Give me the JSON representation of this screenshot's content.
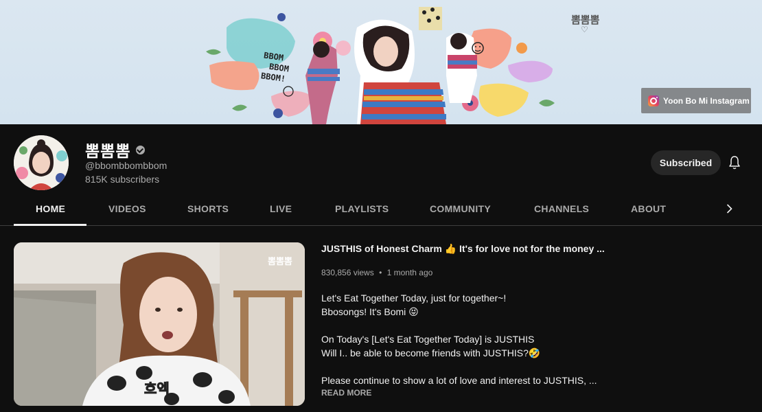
{
  "banner": {
    "brand_logo": "뽐뽐뽐",
    "bbom_text": [
      "BBOM",
      "BBOM",
      "BBOM!"
    ],
    "link_label": "Yoon Bo Mi Instagram",
    "link_icon": "instagram-icon"
  },
  "channel": {
    "name": "뽐뽐뽐",
    "handle": "@bbombbombbom",
    "subscribers": "815K subscribers",
    "subscribe_label": "Subscribed",
    "verified_icon": "verified-check-icon",
    "bell_icon": "bell-icon"
  },
  "tabs": [
    {
      "label": "HOME",
      "active": true
    },
    {
      "label": "VIDEOS"
    },
    {
      "label": "SHORTS"
    },
    {
      "label": "LIVE"
    },
    {
      "label": "PLAYLISTS"
    },
    {
      "label": "COMMUNITY"
    },
    {
      "label": "CHANNELS"
    },
    {
      "label": "ABOUT"
    }
  ],
  "featured": {
    "title": "JUSTHIS of Honest Charm 👍 It's for love not for the money ...",
    "views": "830,856 views",
    "age": "1 month ago",
    "separator": "•",
    "thumb_logo": "뽐뽐뽐",
    "thumb_caption": "흐엑",
    "description": [
      "Let's Eat Together Today, just for together~!",
      "Bbosongs! It's Bomi 😝",
      "",
      "On Today's [Let's Eat Together Today] is JUSTHIS",
      "Will I.. be able to become friends with JUSTHIS?🤣",
      "",
      "Please continue to show a lot of love and interest to JUSTHIS, ..."
    ],
    "read_more": "READ MORE"
  },
  "colors": {
    "background": "#0f0f0f",
    "text": "#f1f1f1",
    "secondary_text": "#aaaaaa",
    "button_bg": "#272727",
    "banner_bg": "#d6e4f0"
  }
}
